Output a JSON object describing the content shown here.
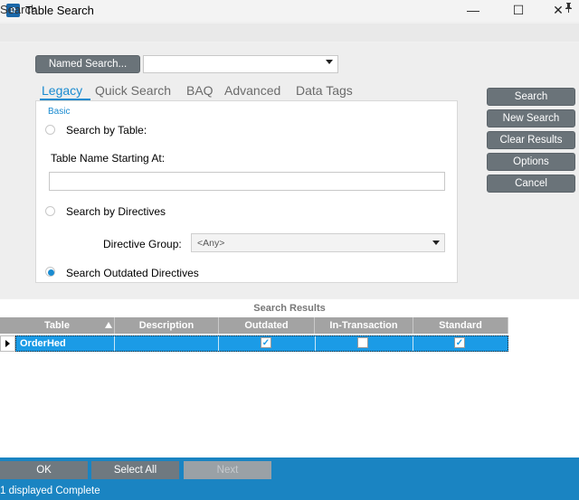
{
  "window": {
    "title": "Table Search",
    "app_icon": "e",
    "controls": {
      "minimize": "—",
      "maximize": "☐",
      "close": "✕"
    }
  },
  "header": {
    "label": "Search",
    "pin_icon": "pin-icon"
  },
  "named_search": {
    "button_label": "Named Search...",
    "value": ""
  },
  "tabs": [
    {
      "label": "Legacy",
      "active": true
    },
    {
      "label": "Quick Search",
      "active": false
    },
    {
      "label": "BAQ",
      "active": false
    },
    {
      "label": "Advanced",
      "active": false
    },
    {
      "label": "Data Tags",
      "active": false
    }
  ],
  "basic": {
    "section_label": "Basic",
    "search_by_table": {
      "label": "Search by Table:",
      "selected": false
    },
    "table_name_label": "Table Name Starting At:",
    "table_name_value": "",
    "search_by_directives": {
      "label": "Search by Directives",
      "selected": false
    },
    "directive_group_label": "Directive Group:",
    "directive_group_value": "<Any>",
    "search_outdated": {
      "label": "Search Outdated Directives",
      "selected": true
    }
  },
  "actions": {
    "search": "Search",
    "new_search": "New Search",
    "clear_results": "Clear Results",
    "options": "Options",
    "cancel": "Cancel"
  },
  "results": {
    "title": "Search Results",
    "columns": [
      "Table",
      "Description",
      "Outdated",
      "In-Transaction",
      "Standard"
    ],
    "rows": [
      {
        "table": "OrderHed",
        "description": "",
        "outdated": true,
        "in_transaction": false,
        "standard": true
      }
    ]
  },
  "footer": {
    "ok": "OK",
    "select_all": "Select All",
    "next": "Next",
    "status": "1 displayed Complete"
  },
  "colors": {
    "accent": "#1a8bd0",
    "button_gray": "#6a7379",
    "footer_blue": "#1a84c2",
    "selected_row": "#1b9be6"
  }
}
